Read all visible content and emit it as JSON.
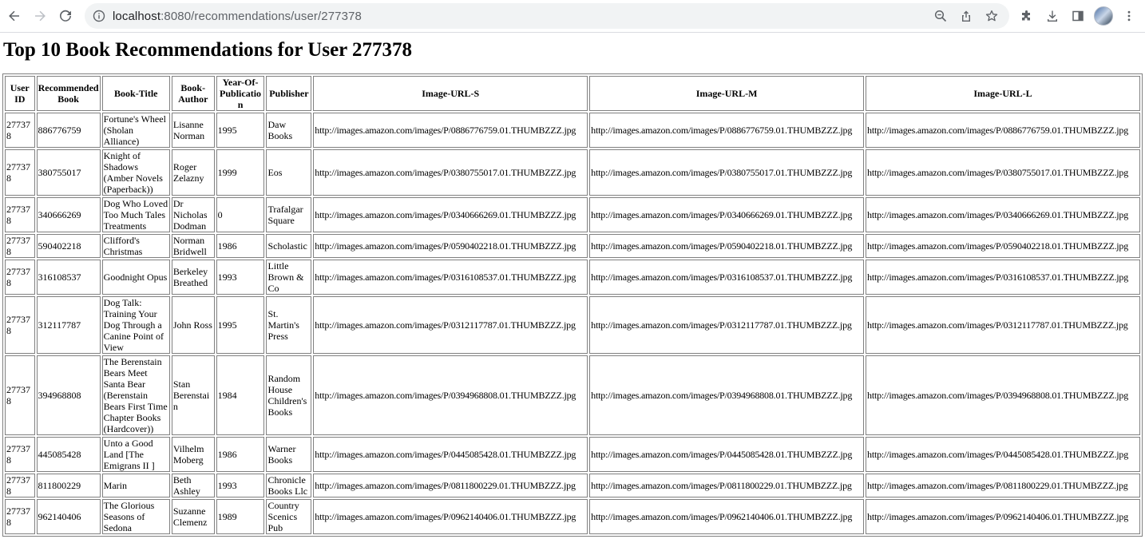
{
  "browser": {
    "url_host": "localhost",
    "url_path": ":8080/recommendations/user/277378"
  },
  "page": {
    "title": "Top 10 Book Recommendations for User 277378"
  },
  "table": {
    "headers": [
      "User ID",
      "Recommended Book",
      "Book-Title",
      "Book-Author",
      "Year-Of-Publication",
      "Publisher",
      "Image-URL-S",
      "Image-URL-M",
      "Image-URL-L"
    ],
    "rows": [
      {
        "user_id": "277378",
        "book": "886776759",
        "title": "Fortune's Wheel (Sholan Alliance)",
        "author": "Lisanne Norman",
        "year": "1995",
        "publisher": "Daw Books",
        "url_s": "http://images.amazon.com/images/P/0886776759.01.THUMBZZZ.jpg",
        "url_m": "http://images.amazon.com/images/P/0886776759.01.THUMBZZZ.jpg",
        "url_l": "http://images.amazon.com/images/P/0886776759.01.THUMBZZZ.jpg"
      },
      {
        "user_id": "277378",
        "book": "380755017",
        "title": "Knight of Shadows (Amber Novels (Paperback))",
        "author": "Roger Zelazny",
        "year": "1999",
        "publisher": "Eos",
        "url_s": "http://images.amazon.com/images/P/0380755017.01.THUMBZZZ.jpg",
        "url_m": "http://images.amazon.com/images/P/0380755017.01.THUMBZZZ.jpg",
        "url_l": "http://images.amazon.com/images/P/0380755017.01.THUMBZZZ.jpg"
      },
      {
        "user_id": "277378",
        "book": "340666269",
        "title": "Dog Who Loved Too Much Tales Treatments",
        "author": "Dr Nicholas Dodman",
        "year": "0",
        "publisher": "Trafalgar Square",
        "url_s": "http://images.amazon.com/images/P/0340666269.01.THUMBZZZ.jpg",
        "url_m": "http://images.amazon.com/images/P/0340666269.01.THUMBZZZ.jpg",
        "url_l": "http://images.amazon.com/images/P/0340666269.01.THUMBZZZ.jpg"
      },
      {
        "user_id": "277378",
        "book": "590402218",
        "title": "Clifford's Christmas",
        "author": "Norman Bridwell",
        "year": "1986",
        "publisher": "Scholastic",
        "url_s": "http://images.amazon.com/images/P/0590402218.01.THUMBZZZ.jpg",
        "url_m": "http://images.amazon.com/images/P/0590402218.01.THUMBZZZ.jpg",
        "url_l": "http://images.amazon.com/images/P/0590402218.01.THUMBZZZ.jpg"
      },
      {
        "user_id": "277378",
        "book": "316108537",
        "title": "Goodnight Opus",
        "author": "Berkeley Breathed",
        "year": "1993",
        "publisher": "Little Brown & Co",
        "url_s": "http://images.amazon.com/images/P/0316108537.01.THUMBZZZ.jpg",
        "url_m": "http://images.amazon.com/images/P/0316108537.01.THUMBZZZ.jpg",
        "url_l": "http://images.amazon.com/images/P/0316108537.01.THUMBZZZ.jpg"
      },
      {
        "user_id": "277378",
        "book": "312117787",
        "title": "Dog Talk: Training Your Dog Through a Canine Point of View",
        "author": "John Ross",
        "year": "1995",
        "publisher": "St. Martin's Press",
        "url_s": "http://images.amazon.com/images/P/0312117787.01.THUMBZZZ.jpg",
        "url_m": "http://images.amazon.com/images/P/0312117787.01.THUMBZZZ.jpg",
        "url_l": "http://images.amazon.com/images/P/0312117787.01.THUMBZZZ.jpg"
      },
      {
        "user_id": "277378",
        "book": "394968808",
        "title": "The Berenstain Bears Meet Santa Bear (Berenstain Bears First Time Chapter Books (Hardcover))",
        "author": "Stan Berenstain",
        "year": "1984",
        "publisher": "Random House Children's Books",
        "url_s": "http://images.amazon.com/images/P/0394968808.01.THUMBZZZ.jpg",
        "url_m": "http://images.amazon.com/images/P/0394968808.01.THUMBZZZ.jpg",
        "url_l": "http://images.amazon.com/images/P/0394968808.01.THUMBZZZ.jpg"
      },
      {
        "user_id": "277378",
        "book": "445085428",
        "title": "Unto a Good Land [The Emigrans II ]",
        "author": "Vilhelm Moberg",
        "year": "1986",
        "publisher": "Warner Books",
        "url_s": "http://images.amazon.com/images/P/0445085428.01.THUMBZZZ.jpg",
        "url_m": "http://images.amazon.com/images/P/0445085428.01.THUMBZZZ.jpg",
        "url_l": "http://images.amazon.com/images/P/0445085428.01.THUMBZZZ.jpg"
      },
      {
        "user_id": "277378",
        "book": "811800229",
        "title": "Marin",
        "author": "Beth Ashley",
        "year": "1993",
        "publisher": "Chronicle Books Llc",
        "url_s": "http://images.amazon.com/images/P/0811800229.01.THUMBZZZ.jpg",
        "url_m": "http://images.amazon.com/images/P/0811800229.01.THUMBZZZ.jpg",
        "url_l": "http://images.amazon.com/images/P/0811800229.01.THUMBZZZ.jpg"
      },
      {
        "user_id": "277378",
        "book": "962140406",
        "title": "The Glorious Seasons of Sedona",
        "author": "Suzanne Clemenz",
        "year": "1989",
        "publisher": "Country Scenics Pub",
        "url_s": "http://images.amazon.com/images/P/0962140406.01.THUMBZZZ.jpg",
        "url_m": "http://images.amazon.com/images/P/0962140406.01.THUMBZZZ.jpg",
        "url_l": "http://images.amazon.com/images/P/0962140406.01.THUMBZZZ.jpg"
      }
    ]
  }
}
